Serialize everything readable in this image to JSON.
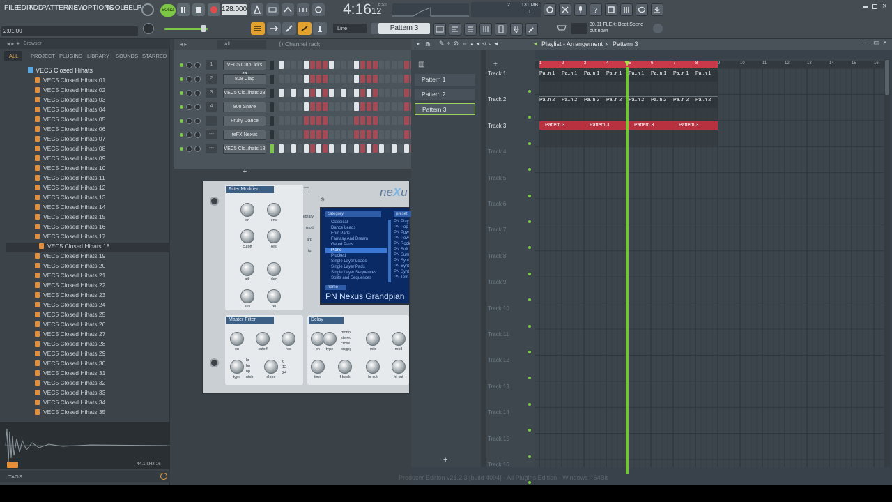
{
  "menu": {
    "items": [
      "FILE",
      "EDIT",
      "ADD",
      "PATTERNS",
      "VIEW",
      "OPTIONS",
      "TOOLS",
      "HELP"
    ]
  },
  "transport": {
    "mode_label": "SONG",
    "tempo": "128.000",
    "time_main": "4:16",
    "time_sub": "12",
    "time_unit": "B:S:T"
  },
  "position_readout": "2:01:00",
  "cpu_info": {
    "cpu": "2",
    "mem": "131 MB",
    "poly": "1"
  },
  "toolbar": {
    "snap_label": "Line",
    "pattern_select": "Pattern 3"
  },
  "news": {
    "line1": "30.01  FLEX: Beat Scene",
    "line2": "out now!"
  },
  "browser": {
    "title": "Browser",
    "tabs": [
      "ALL",
      "PROJECT",
      "PLUGINS",
      "LIBRARY",
      "SOUNDS",
      "STARRED"
    ],
    "active_tab": "ALL",
    "folder": "VEC5 Closed Hihats",
    "items": [
      "VEC5 Closed Hihats 01",
      "VEC5 Closed Hihats 02",
      "VEC5 Closed Hihats 03",
      "VEC5 Closed Hihats 04",
      "VEC5 Closed Hihats 05",
      "VEC5 Closed Hihats 06",
      "VEC5 Closed Hihats 07",
      "VEC5 Closed Hihats 08",
      "VEC5 Closed Hihats 09",
      "VEC5 Closed Hihats 10",
      "VEC5 Closed Hihats 11",
      "VEC5 Closed Hihats 12",
      "VEC5 Closed Hihats 13",
      "VEC5 Closed Hihats 14",
      "VEC5 Closed Hihats 15",
      "VEC5 Closed Hihats 16",
      "VEC5 Closed Hihats 17",
      "VEC5 Closed Hihats 18",
      "VEC5 Closed Hihats 19",
      "VEC5 Closed Hihats 20",
      "VEC5 Closed Hihats 21",
      "VEC5 Closed Hihats 22",
      "VEC5 Closed Hihats 23",
      "VEC5 Closed Hihats 24",
      "VEC5 Closed Hihats 25",
      "VEC5 Closed Hihats 26",
      "VEC5 Closed Hihats 27",
      "VEC5 Closed Hihats 28",
      "VEC5 Closed Hihats 29",
      "VEC5 Closed Hihats 30",
      "VEC5 Closed Hihats 31",
      "VEC5 Closed Hihats 32",
      "VEC5 Closed Hihats 33",
      "VEC5 Closed Hihats 34",
      "VEC5 Closed Hihats 35"
    ],
    "selected_index": 17,
    "sample_info": "44.1 kHz 16",
    "tags_label": "TAGS"
  },
  "channel_rack": {
    "title": "Channel rack",
    "filter": "All",
    "channels": [
      {
        "num": "1",
        "name": "VEC5 Club..icks 43"
      },
      {
        "num": "2",
        "name": "808 Clap"
      },
      {
        "num": "3",
        "name": "VEC5 Clo..ihats 28"
      },
      {
        "num": "4",
        "name": "808 Snare"
      },
      {
        "num": "",
        "name": "Fruity Dance"
      },
      {
        "num": "---",
        "name": "reFX Nexus"
      },
      {
        "num": "---",
        "name": "VEC5 Clo..ihats 18"
      }
    ],
    "add_label": "+"
  },
  "nexus": {
    "filter_modifier": "Filter Modifier",
    "knobs_fm": [
      "on",
      "env",
      "cutoff",
      "res",
      "atk",
      "dec",
      "sus",
      "rel"
    ],
    "side_tabs": [
      "library",
      "mod",
      "arp",
      "tg"
    ],
    "category_header": "category",
    "preset_header": "preset",
    "categories": [
      "Classical",
      "Dance Leads",
      "Epic Pads",
      "Fantasy And Dream",
      "Gated Pads",
      "Piano",
      "Plucked",
      "Single Layer Leads",
      "Single Layer Pads",
      "Single Layer Sequences",
      "Splits and Sequences"
    ],
    "selected_category": "Piano",
    "presets": [
      "PN Play",
      "PN Pop",
      "PN Pow",
      "PN Pow",
      "PN Rock",
      "PN Soft",
      "PN Sum",
      "PN Synt",
      "PN Synt",
      "PN Synt",
      "PN Tem"
    ],
    "name_label": "name",
    "preset_name": "PN Nexus Grandpian",
    "master_filter": "Master Filter",
    "mf_knobs": [
      "on",
      "cutoff",
      "res",
      "type",
      "slope"
    ],
    "filter_types": [
      "lp",
      "hp",
      "bp",
      "ntch"
    ],
    "slopes": [
      "6",
      "12",
      "24"
    ],
    "delay": "Delay",
    "delay_knobs": [
      "on",
      "type",
      "mix",
      "mod",
      "time",
      "f-back",
      "lo-cut",
      "hi-cut"
    ],
    "delay_modes": [
      "mono",
      "stereo",
      "cross",
      "pngpg"
    ]
  },
  "playlist": {
    "title": "Playlist - Arrangement",
    "crumb": "Pattern 3",
    "patterns": [
      "Pattern 1",
      "Pattern 2",
      "Pattern 3"
    ],
    "ruler": [
      "1",
      "2",
      "3",
      "4",
      "5",
      "6",
      "7",
      "8",
      "9",
      "10",
      "11",
      "12",
      "13",
      "14",
      "15",
      "16"
    ],
    "tracks": [
      "Track 1",
      "Track 2",
      "Track 3",
      "Track 4",
      "Track 5",
      "Track 6",
      "Track 7",
      "Track 8",
      "Track 9",
      "Track 10",
      "Track 11",
      "Track 12",
      "Track 13",
      "Track 14",
      "Track 15",
      "Track 16"
    ],
    "clip_pattern3": "Pattern 3",
    "clip_short1": "Pa..n 1",
    "clip_short2": "Pa..n 2",
    "add_label": "+"
  },
  "footer_text": "Producer Edition v21.2.3 [build 4004] - All Plugins Edition - Windows - 64Bit"
}
